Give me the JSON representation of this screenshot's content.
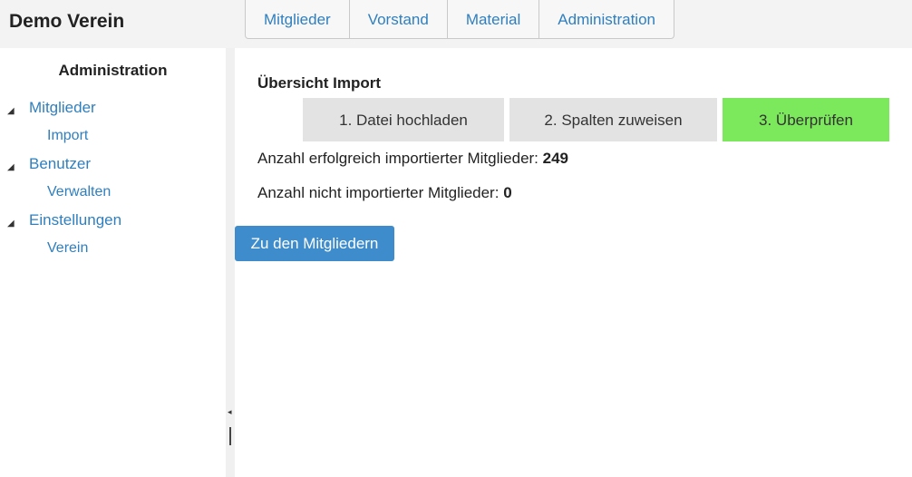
{
  "app": {
    "title": "Demo Verein"
  },
  "nav": {
    "tabs": [
      {
        "label": "Mitglieder"
      },
      {
        "label": "Vorstand"
      },
      {
        "label": "Material"
      },
      {
        "label": "Administration"
      }
    ]
  },
  "sidebar": {
    "heading": "Administration",
    "tree": [
      {
        "label": "Mitglieder",
        "toggle_icon": "triangle-expanded-icon",
        "children": [
          {
            "label": "Import"
          }
        ]
      },
      {
        "label": "Benutzer",
        "toggle_icon": "triangle-expanded-icon",
        "children": [
          {
            "label": "Verwalten"
          }
        ]
      },
      {
        "label": "Einstellungen",
        "toggle_icon": "triangle-expanded-icon",
        "children": [
          {
            "label": "Verein"
          }
        ]
      }
    ]
  },
  "main": {
    "title": "Übersicht Import",
    "steps": [
      {
        "label": "1. Datei hochladen",
        "active": false
      },
      {
        "label": "2. Spalten zuweisen",
        "active": false
      },
      {
        "label": "3. Überprüfen",
        "active": true
      }
    ],
    "stats": [
      {
        "label": "Anzahl erfolgreich importierter Mitglieder:",
        "value": "249"
      },
      {
        "label": "Anzahl nicht importierter Mitglieder:",
        "value": "0"
      }
    ],
    "button_label": "Zu den Mitgliedern"
  },
  "colors": {
    "accent": "#2f7fbf",
    "button": "#3e8ccb",
    "step_active": "#7ce85c",
    "step_inactive": "#e3e3e3"
  }
}
